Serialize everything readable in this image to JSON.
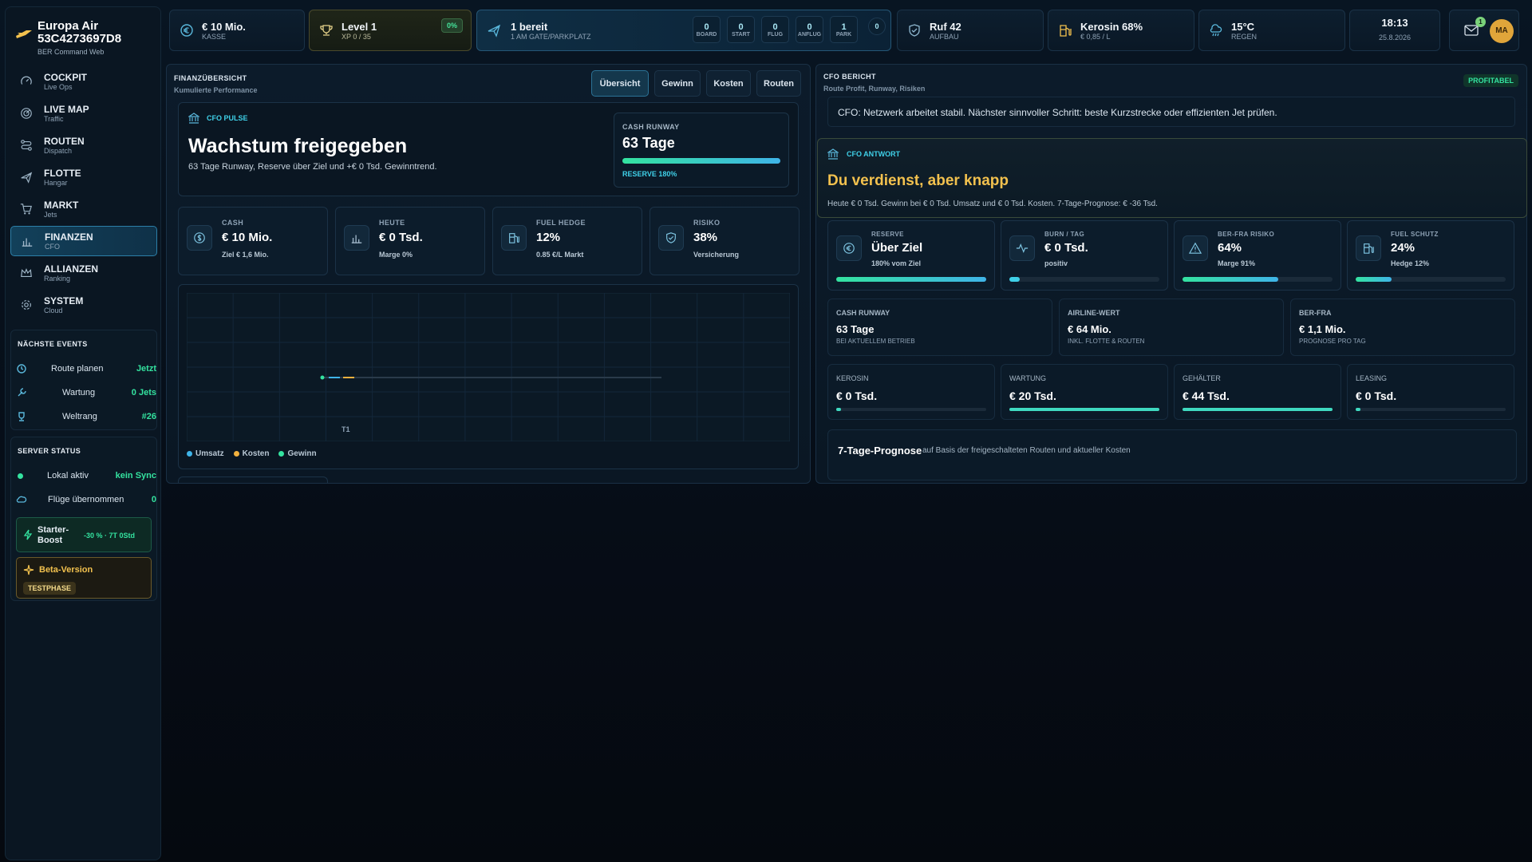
{
  "brand": {
    "name": "Europa Air",
    "code": "53C4273697D8",
    "subtitle": "BER Command Web"
  },
  "nav": [
    {
      "title": "COCKPIT",
      "sub": "Live Ops",
      "icon": "gauge-icon"
    },
    {
      "title": "LIVE MAP",
      "sub": "Traffic",
      "icon": "radar-icon"
    },
    {
      "title": "ROUTEN",
      "sub": "Dispatch",
      "icon": "route-icon"
    },
    {
      "title": "FLOTTE",
      "sub": "Hangar",
      "icon": "plane-icon"
    },
    {
      "title": "MARKT",
      "sub": "Jets",
      "icon": "cart-icon"
    },
    {
      "title": "FINANZEN",
      "sub": "CFO",
      "icon": "bar-chart-icon",
      "active": true
    },
    {
      "title": "ALLIANZEN",
      "sub": "Ranking",
      "icon": "crown-icon"
    },
    {
      "title": "SYSTEM",
      "sub": "Cloud",
      "icon": "gear-icon"
    }
  ],
  "events": {
    "title": "NÄCHSTE EVENTS",
    "items": [
      {
        "label": "Route planen",
        "value": "Jetzt"
      },
      {
        "label": "Wartung",
        "value": "0 Jets"
      },
      {
        "label": "Weltrang",
        "value": "#26"
      }
    ]
  },
  "server": {
    "title": "SERVER STATUS",
    "items": [
      {
        "label": "Lokal aktiv",
        "value": "kein Sync"
      },
      {
        "label": "Flüge übernommen",
        "value": "0"
      }
    ],
    "boost_label": "Starter-Boost",
    "boost_value": "-30 % · 7T 0Std",
    "beta_label": "Beta-Version",
    "beta_badge": "TESTPHASE"
  },
  "topbar": {
    "cash": {
      "value": "€ 10 Mio.",
      "label": "KASSE"
    },
    "level": {
      "value": "Level 1",
      "label": "XP 0 / 35",
      "pct": "0%"
    },
    "flights": {
      "value": "1 bereit",
      "label": "1 AM GATE/PARKPLATZ",
      "stages": [
        {
          "n": "0",
          "c": "BOARD"
        },
        {
          "n": "0",
          "c": "START"
        },
        {
          "n": "0",
          "c": "FLUG"
        },
        {
          "n": "0",
          "c": "ANFLUG"
        },
        {
          "n": "1",
          "c": "PARK"
        }
      ],
      "extra": "0"
    },
    "reputation": {
      "value": "Ruf 42",
      "label": "AUFBAU"
    },
    "fuel": {
      "value": "Kerosin 68%",
      "label": "€ 0,85 / L"
    },
    "weather": {
      "value": "15°C",
      "label": "REGEN"
    },
    "clock": {
      "time": "18:13",
      "date": "25.8.2026"
    },
    "mail_badge": "1",
    "avatar": "MA"
  },
  "finance": {
    "title": "FINANZÜBERSICHT",
    "subtitle": "Kumulierte Performance",
    "tabs": [
      "Übersicht",
      "Gewinn",
      "Kosten",
      "Routen"
    ],
    "pulse": {
      "tag": "CFO PULSE",
      "headline": "Wachstum freigegeben",
      "text": "63 Tage Runway, Reserve über Ziel und +€ 0 Tsd. Gewinntrend.",
      "runway_label": "CASH RUNWAY",
      "runway_value": "63 Tage",
      "reserve": "RESERVE 180%",
      "runway_fill": 1.0
    },
    "kpis": [
      {
        "label": "CASH",
        "value": "€ 10 Mio.",
        "sub": "Ziel € 1,6 Mio.",
        "icon": "dollar-icon"
      },
      {
        "label": "HEUTE",
        "value": "€ 0 Tsd.",
        "sub": "Marge 0%",
        "icon": "bar-chart-icon"
      },
      {
        "label": "FUEL HEDGE",
        "value": "12%",
        "sub": "0.85 €/L Markt",
        "icon": "fuel-icon"
      },
      {
        "label": "RISIKO",
        "value": "38%",
        "sub": "Versicherung",
        "icon": "shield-icon"
      }
    ],
    "legend": [
      "Umsatz",
      "Kosten",
      "Gewinn"
    ]
  },
  "chart_data": {
    "type": "line",
    "categories": [
      "T1"
    ],
    "series": [
      {
        "name": "Umsatz",
        "values": [
          0
        ]
      },
      {
        "name": "Kosten",
        "values": [
          0
        ]
      },
      {
        "name": "Gewinn",
        "values": [
          0
        ]
      }
    ],
    "colors": [
      "#3fb4e8",
      "#f2b13e",
      "#34e3a0"
    ],
    "grid": true,
    "legend": "bottom-left"
  },
  "cfo": {
    "title": "CFO BERICHT",
    "subtitle": "Route Profit, Runway, Risiken",
    "badge": "PROFITABEL",
    "message": "CFO: Netzwerk arbeitet stabil. Nächster sinnvoller Schritt: beste Kurzstrecke oder effizienten Jet prüfen.",
    "answer_tag": "CFO ANTWORT",
    "answer_headline": "Du verdienst, aber knapp",
    "answer_text": "Heute € 0 Tsd. Gewinn bei € 0 Tsd. Umsatz und € 0 Tsd. Kosten. 7-Tage-Prognose: € -36 Tsd.",
    "cards": [
      {
        "label": "RESERVE",
        "value": "Über Ziel",
        "sub": "180% vom Ziel",
        "fill": 1.0,
        "color": "grad",
        "icon": "euro-icon"
      },
      {
        "label": "BURN / TAG",
        "value": "€ 0 Tsd.",
        "sub": "positiv",
        "fill": 0.07,
        "color": "#3fd0e8",
        "icon": "pulse-icon"
      },
      {
        "label": "BER-FRA RISIKO",
        "value": "64%",
        "sub": "Marge 91%",
        "fill": 0.64,
        "color": "grad",
        "icon": "warning-icon"
      },
      {
        "label": "FUEL SCHUTZ",
        "value": "24%",
        "sub": "Hedge 12%",
        "fill": 0.24,
        "color": "grad",
        "icon": "fuel-icon"
      }
    ],
    "info": [
      {
        "label": "CASH RUNWAY",
        "value": "63 Tage",
        "sub": "BEI AKTUELLEM BETRIEB"
      },
      {
        "label": "AIRLINE-WERT",
        "value": "€ 64 Mio.",
        "sub": "INKL. FLOTTE & ROUTEN"
      },
      {
        "label": "BER-FRA",
        "value": "€ 1,1 Mio.",
        "sub": "PROGNOSE PRO TAG"
      }
    ],
    "costs": [
      {
        "label": "KEROSIN",
        "value": "€ 0 Tsd.",
        "fill": 0.03
      },
      {
        "label": "WARTUNG",
        "value": "€ 20 Tsd.",
        "fill": 1.0
      },
      {
        "label": "GEHÄLTER",
        "value": "€ 44 Tsd.",
        "fill": 1.0
      },
      {
        "label": "LEASING",
        "value": "€ 0 Tsd.",
        "fill": 0.03
      }
    ],
    "forecast_title": "7-Tage-Prognose",
    "forecast_sub": "auf Basis der freigeschalteten Routen und aktueller Kosten"
  }
}
